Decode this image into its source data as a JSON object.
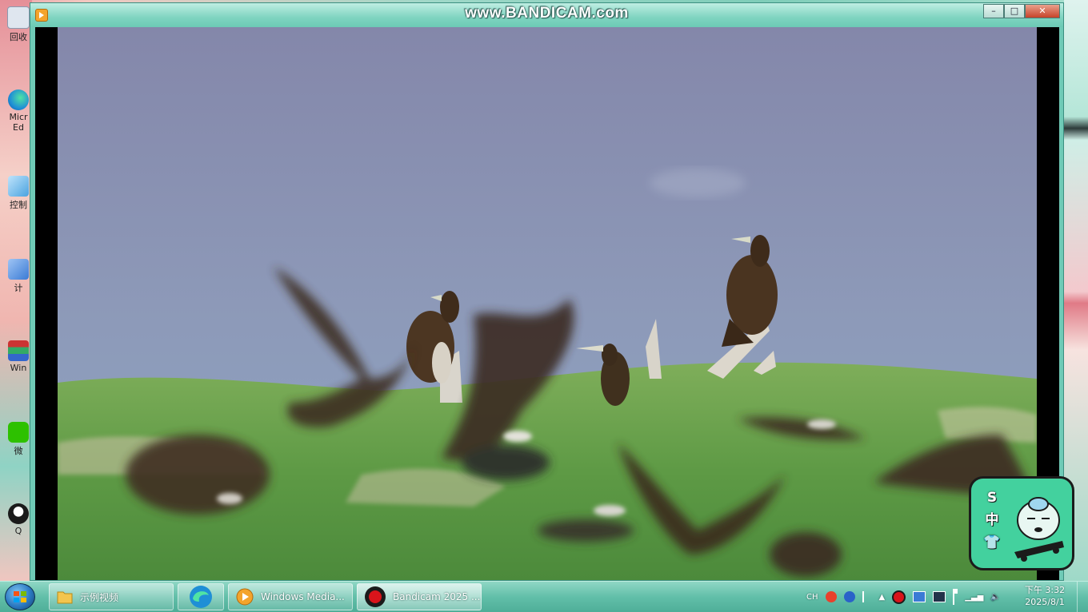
{
  "desktop": {
    "icons": [
      {
        "label": "回收",
        "icon": "recycle-bin-icon",
        "color": "#dfe6ef"
      },
      {
        "label": "Micr Ed",
        "icon": "edge-icon",
        "color": "#1f8fd6"
      },
      {
        "label": "控制",
        "icon": "control-panel-icon",
        "color": "#4aa3e0"
      },
      {
        "label": "计",
        "icon": "computer-icon",
        "color": "#3a7bd5"
      },
      {
        "label": "Win",
        "icon": "winrar-icon",
        "color": "#b23a7a"
      },
      {
        "label": "微",
        "icon": "wechat-icon",
        "color": "#2dc100"
      },
      {
        "label": "Q",
        "icon": "qq-icon",
        "color": "#1a1a1a"
      }
    ]
  },
  "window": {
    "watermark": "www.BANDICAM.com",
    "buttons": {
      "minimize": "–",
      "maximize": "□",
      "close": "✕"
    }
  },
  "sogou": {
    "letters": [
      "S",
      "中",
      "👕"
    ]
  },
  "taskbar": {
    "items": [
      {
        "label": "示例视频",
        "icon": "folder-icon"
      },
      {
        "label": "",
        "icon": "edge-icon"
      },
      {
        "label": "Windows Media...",
        "icon": "media-player-icon"
      },
      {
        "label": "Bandicam 2025 ...",
        "icon": "bandicam-icon"
      }
    ],
    "tray": {
      "lang": "CH"
    },
    "clock": {
      "time": "下午 3:32",
      "date": "2025/8/1"
    }
  },
  "colors": {
    "accent": "#6fcab6",
    "sogou": "#43d19e",
    "record": "#d9141b"
  }
}
